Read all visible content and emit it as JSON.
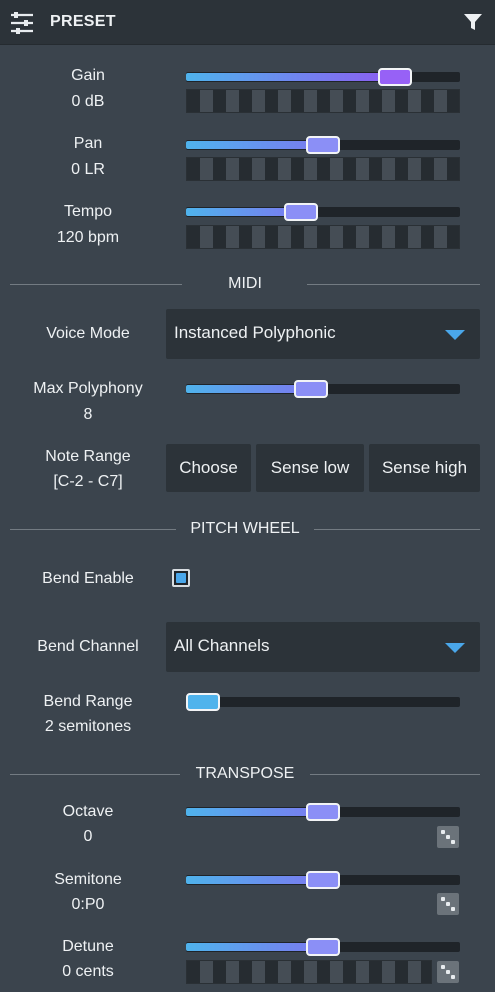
{
  "header": {
    "title": "PRESET"
  },
  "params": {
    "gain": {
      "label": "Gain",
      "value": "0 dB",
      "level": 0.8
    },
    "pan": {
      "label": "Pan",
      "value": "0 LR",
      "level": 0.5
    },
    "tempo": {
      "label": "Tempo",
      "value": "120 bpm",
      "level": 0.41
    }
  },
  "midi": {
    "title": "MIDI",
    "voice_mode": {
      "label": "Voice Mode",
      "value": "Instanced Polyphonic"
    },
    "max_polyphony": {
      "label": "Max Polyphony",
      "value": "8",
      "level": 0.45
    },
    "note_range": {
      "label": "Note Range",
      "value": "[C-2 - C7]",
      "buttons": [
        "Choose",
        "Sense low",
        "Sense high"
      ]
    }
  },
  "pitch_wheel": {
    "title": "PITCH WHEEL",
    "bend_enable": {
      "label": "Bend Enable",
      "checked": true
    },
    "bend_channel": {
      "label": "Bend Channel",
      "value": "All Channels"
    },
    "bend_range": {
      "label": "Bend Range",
      "value": "2 semitones",
      "level": 0.0
    }
  },
  "transpose": {
    "title": "TRANSPOSE",
    "octave": {
      "label": "Octave",
      "value": "0",
      "level": 0.5
    },
    "semitone": {
      "label": "Semitone",
      "value": "0:P0",
      "level": 0.5
    },
    "detune": {
      "label": "Detune",
      "value": "0 cents",
      "level": 0.5
    }
  },
  "colors": {
    "accent": "#4aa7ea",
    "thumb": "#8b8ff6",
    "thumb_gain": "#9761f6",
    "background": "#3b444d"
  }
}
